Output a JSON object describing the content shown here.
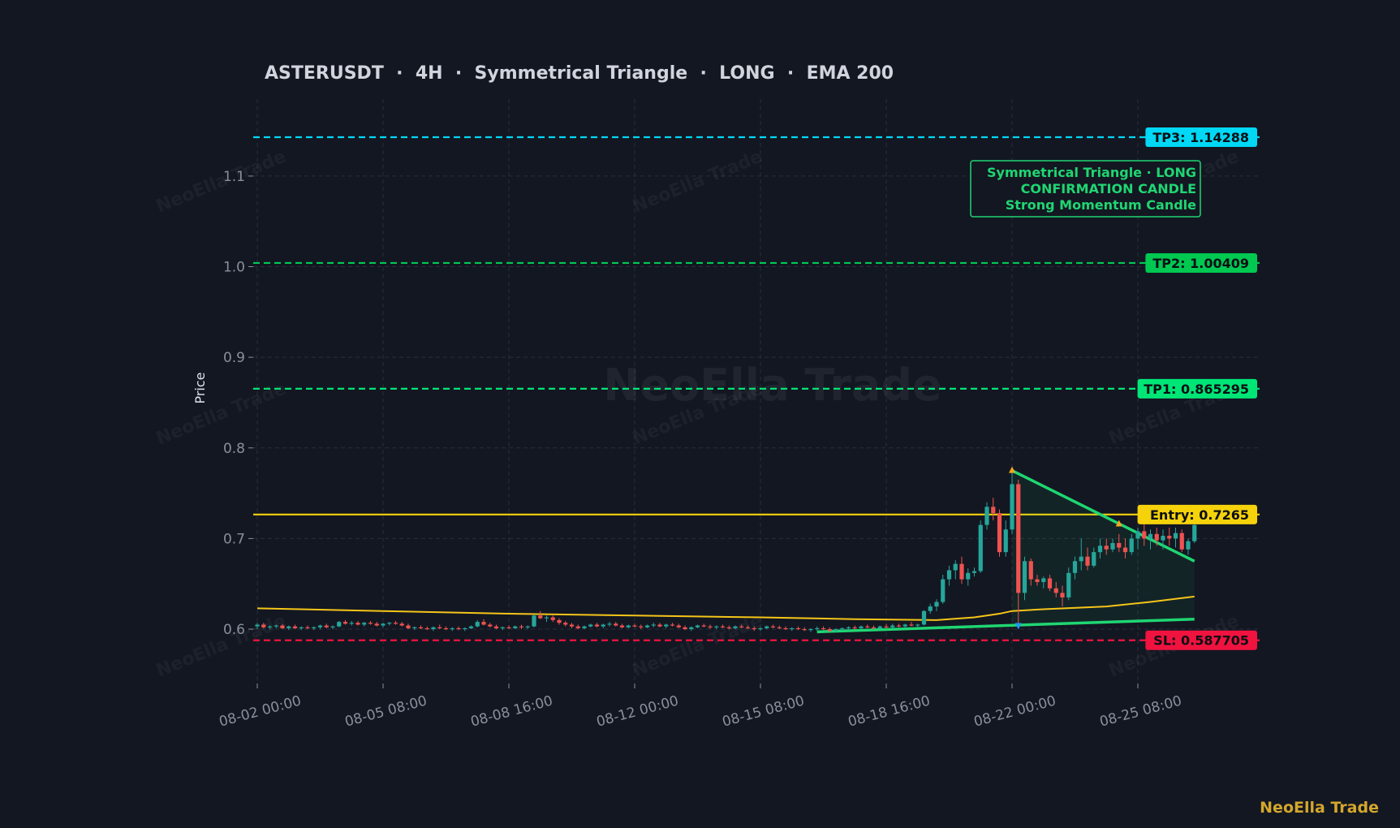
{
  "chart_data": {
    "type": "candlestick",
    "title": "ASTERUSDT  ·  4H  ·  Symmetrical Triangle  ·  LONG  ·  EMA 200",
    "symbol": "ASTERUSDT",
    "timeframe": "4H",
    "ylabel": "Price",
    "xlabel": "",
    "ylim": [
      0.54,
      1.185
    ],
    "y_ticks": [
      0.6,
      0.7,
      0.8,
      0.9,
      1.0,
      1.1
    ],
    "x_ticks": [
      "08-02 00:00",
      "08-05 08:00",
      "08-08 16:00",
      "08-12 00:00",
      "08-15 08:00",
      "08-18 16:00",
      "08-22 00:00",
      "08-25 08:00"
    ],
    "x_tick_bar_index": [
      0,
      20,
      40,
      60,
      80,
      100,
      120,
      140
    ],
    "grid": true,
    "watermark": "NeoElla Trade",
    "levels": [
      {
        "name": "TP3",
        "label": "TP3: 1.14288",
        "value": 1.14288,
        "color": "#00d8f5",
        "style": "dashed"
      },
      {
        "name": "TP2",
        "label": "TP2: 1.00409",
        "value": 1.00409,
        "color": "#00c851",
        "style": "dashed"
      },
      {
        "name": "TP1",
        "label": "TP1: 0.865295",
        "value": 0.865295,
        "color": "#00e676",
        "style": "dashed"
      },
      {
        "name": "Entry",
        "label": "Entry: 0.7265",
        "value": 0.7265,
        "color": "#f5d20a",
        "style": "solid"
      },
      {
        "name": "SL",
        "label": "SL: 0.587705",
        "value": 0.587705,
        "color": "#f0133f",
        "style": "dashed"
      }
    ],
    "annotation": {
      "lines": [
        "Symmetrical Triangle · LONG",
        "CONFIRMATION CANDLE",
        "Strong Momentum Candle"
      ],
      "color": "#1fd672"
    },
    "pattern": {
      "name": "Symmetrical Triangle",
      "upper_line": [
        [
          120,
          0.775
        ],
        [
          149,
          0.675
        ]
      ],
      "lower_line": [
        [
          89,
          0.597
        ],
        [
          149,
          0.611
        ]
      ],
      "peaks": [
        [
          120,
          0.775
        ],
        [
          137,
          0.716
        ]
      ],
      "troughs": [
        [
          121,
          0.604
        ]
      ]
    },
    "ema": {
      "name": "EMA 200",
      "color": "#f5c518",
      "points": [
        [
          0,
          0.623
        ],
        [
          20,
          0.62
        ],
        [
          40,
          0.617
        ],
        [
          60,
          0.615
        ],
        [
          80,
          0.613
        ],
        [
          95,
          0.611
        ],
        [
          108,
          0.61
        ],
        [
          114,
          0.613
        ],
        [
          118,
          0.617
        ],
        [
          120,
          0.62
        ],
        [
          125,
          0.622
        ],
        [
          135,
          0.625
        ],
        [
          142,
          0.63
        ],
        [
          149,
          0.636
        ]
      ]
    },
    "candles": [
      [
        0.603,
        0.607,
        0.6,
        0.605
      ],
      [
        0.605,
        0.607,
        0.601,
        0.602
      ],
      [
        0.602,
        0.604,
        0.6,
        0.603
      ],
      [
        0.603,
        0.605,
        0.601,
        0.604
      ],
      [
        0.604,
        0.606,
        0.6,
        0.601
      ],
      [
        0.601,
        0.604,
        0.599,
        0.603
      ],
      [
        0.603,
        0.605,
        0.6,
        0.601
      ],
      [
        0.601,
        0.603,
        0.599,
        0.602
      ],
      [
        0.602,
        0.604,
        0.6,
        0.601
      ],
      [
        0.601,
        0.603,
        0.599,
        0.602
      ],
      [
        0.602,
        0.605,
        0.6,
        0.604
      ],
      [
        0.604,
        0.606,
        0.601,
        0.602
      ],
      [
        0.602,
        0.604,
        0.6,
        0.603
      ],
      [
        0.603,
        0.609,
        0.602,
        0.608
      ],
      [
        0.608,
        0.61,
        0.605,
        0.606
      ],
      [
        0.606,
        0.609,
        0.604,
        0.607
      ],
      [
        0.607,
        0.609,
        0.604,
        0.605
      ],
      [
        0.605,
        0.608,
        0.603,
        0.607
      ],
      [
        0.607,
        0.609,
        0.605,
        0.606
      ],
      [
        0.606,
        0.608,
        0.603,
        0.604
      ],
      [
        0.604,
        0.607,
        0.602,
        0.606
      ],
      [
        0.606,
        0.608,
        0.604,
        0.607
      ],
      [
        0.607,
        0.609,
        0.605,
        0.606
      ],
      [
        0.606,
        0.608,
        0.603,
        0.604
      ],
      [
        0.604,
        0.606,
        0.6,
        0.601
      ],
      [
        0.601,
        0.603,
        0.599,
        0.602
      ],
      [
        0.602,
        0.604,
        0.6,
        0.601
      ],
      [
        0.601,
        0.603,
        0.599,
        0.6
      ],
      [
        0.6,
        0.603,
        0.598,
        0.602
      ],
      [
        0.602,
        0.605,
        0.6,
        0.601
      ],
      [
        0.601,
        0.603,
        0.599,
        0.6
      ],
      [
        0.6,
        0.602,
        0.598,
        0.601
      ],
      [
        0.601,
        0.603,
        0.599,
        0.6
      ],
      [
        0.6,
        0.602,
        0.598,
        0.601
      ],
      [
        0.601,
        0.604,
        0.6,
        0.603
      ],
      [
        0.603,
        0.61,
        0.602,
        0.608
      ],
      [
        0.608,
        0.611,
        0.604,
        0.605
      ],
      [
        0.605,
        0.607,
        0.602,
        0.603
      ],
      [
        0.603,
        0.605,
        0.6,
        0.601
      ],
      [
        0.601,
        0.603,
        0.599,
        0.602
      ],
      [
        0.602,
        0.604,
        0.6,
        0.601
      ],
      [
        0.601,
        0.604,
        0.6,
        0.603
      ],
      [
        0.603,
        0.605,
        0.6,
        0.602
      ],
      [
        0.602,
        0.604,
        0.6,
        0.603
      ],
      [
        0.603,
        0.616,
        0.602,
        0.615
      ],
      [
        0.615,
        0.62,
        0.611,
        0.612
      ],
      [
        0.612,
        0.615,
        0.608,
        0.613
      ],
      [
        0.613,
        0.615,
        0.608,
        0.61
      ],
      [
        0.61,
        0.612,
        0.605,
        0.607
      ],
      [
        0.607,
        0.609,
        0.603,
        0.605
      ],
      [
        0.605,
        0.607,
        0.601,
        0.603
      ],
      [
        0.603,
        0.605,
        0.6,
        0.601
      ],
      [
        0.601,
        0.604,
        0.6,
        0.603
      ],
      [
        0.603,
        0.606,
        0.602,
        0.605
      ],
      [
        0.605,
        0.607,
        0.602,
        0.603
      ],
      [
        0.603,
        0.606,
        0.601,
        0.605
      ],
      [
        0.605,
        0.608,
        0.603,
        0.606
      ],
      [
        0.606,
        0.608,
        0.603,
        0.604
      ],
      [
        0.604,
        0.606,
        0.601,
        0.602
      ],
      [
        0.602,
        0.605,
        0.601,
        0.604
      ],
      [
        0.604,
        0.606,
        0.602,
        0.603
      ],
      [
        0.603,
        0.605,
        0.6,
        0.602
      ],
      [
        0.602,
        0.605,
        0.601,
        0.604
      ],
      [
        0.604,
        0.607,
        0.602,
        0.605
      ],
      [
        0.605,
        0.607,
        0.602,
        0.603
      ],
      [
        0.603,
        0.606,
        0.601,
        0.605
      ],
      [
        0.605,
        0.607,
        0.603,
        0.604
      ],
      [
        0.604,
        0.606,
        0.601,
        0.602
      ],
      [
        0.602,
        0.604,
        0.599,
        0.6
      ],
      [
        0.6,
        0.603,
        0.598,
        0.602
      ],
      [
        0.602,
        0.605,
        0.601,
        0.604
      ],
      [
        0.604,
        0.606,
        0.602,
        0.603
      ],
      [
        0.603,
        0.605,
        0.6,
        0.602
      ],
      [
        0.602,
        0.604,
        0.6,
        0.603
      ],
      [
        0.603,
        0.605,
        0.601,
        0.602
      ],
      [
        0.602,
        0.604,
        0.6,
        0.601
      ],
      [
        0.601,
        0.604,
        0.6,
        0.603
      ],
      [
        0.603,
        0.605,
        0.601,
        0.602
      ],
      [
        0.602,
        0.604,
        0.6,
        0.601
      ],
      [
        0.601,
        0.603,
        0.598,
        0.6
      ],
      [
        0.6,
        0.602,
        0.598,
        0.601
      ],
      [
        0.601,
        0.604,
        0.6,
        0.603
      ],
      [
        0.603,
        0.605,
        0.601,
        0.602
      ],
      [
        0.602,
        0.604,
        0.6,
        0.601
      ],
      [
        0.601,
        0.603,
        0.599,
        0.6
      ],
      [
        0.6,
        0.602,
        0.598,
        0.601
      ],
      [
        0.601,
        0.603,
        0.599,
        0.6
      ],
      [
        0.6,
        0.602,
        0.598,
        0.599
      ],
      [
        0.599,
        0.601,
        0.597,
        0.6
      ],
      [
        0.6,
        0.603,
        0.598,
        0.601
      ],
      [
        0.601,
        0.603,
        0.599,
        0.6
      ],
      [
        0.6,
        0.602,
        0.597,
        0.598
      ],
      [
        0.598,
        0.601,
        0.597,
        0.6
      ],
      [
        0.6,
        0.602,
        0.598,
        0.601
      ],
      [
        0.601,
        0.603,
        0.599,
        0.602
      ],
      [
        0.602,
        0.604,
        0.6,
        0.601
      ],
      [
        0.601,
        0.604,
        0.6,
        0.603
      ],
      [
        0.603,
        0.605,
        0.601,
        0.602
      ],
      [
        0.602,
        0.604,
        0.6,
        0.601
      ],
      [
        0.601,
        0.604,
        0.6,
        0.603
      ],
      [
        0.603,
        0.606,
        0.601,
        0.602
      ],
      [
        0.602,
        0.606,
        0.601,
        0.604
      ],
      [
        0.604,
        0.606,
        0.602,
        0.603
      ],
      [
        0.603,
        0.606,
        0.601,
        0.605
      ],
      [
        0.605,
        0.608,
        0.603,
        0.604
      ],
      [
        0.604,
        0.606,
        0.602,
        0.605
      ],
      [
        0.605,
        0.621,
        0.604,
        0.62
      ],
      [
        0.62,
        0.628,
        0.617,
        0.625
      ],
      [
        0.625,
        0.633,
        0.62,
        0.63
      ],
      [
        0.63,
        0.66,
        0.628,
        0.655
      ],
      [
        0.655,
        0.67,
        0.648,
        0.665
      ],
      [
        0.665,
        0.676,
        0.655,
        0.672
      ],
      [
        0.672,
        0.68,
        0.65,
        0.655
      ],
      [
        0.655,
        0.667,
        0.648,
        0.662
      ],
      [
        0.662,
        0.668,
        0.658,
        0.664
      ],
      [
        0.664,
        0.72,
        0.662,
        0.715
      ],
      [
        0.715,
        0.74,
        0.71,
        0.735
      ],
      [
        0.735,
        0.745,
        0.72,
        0.728
      ],
      [
        0.728,
        0.732,
        0.68,
        0.685
      ],
      [
        0.685,
        0.72,
        0.68,
        0.71
      ],
      [
        0.71,
        0.775,
        0.705,
        0.76
      ],
      [
        0.76,
        0.765,
        0.604,
        0.64
      ],
      [
        0.64,
        0.68,
        0.632,
        0.675
      ],
      [
        0.675,
        0.678,
        0.648,
        0.655
      ],
      [
        0.655,
        0.66,
        0.648,
        0.652
      ],
      [
        0.652,
        0.658,
        0.645,
        0.656
      ],
      [
        0.656,
        0.66,
        0.642,
        0.645
      ],
      [
        0.645,
        0.652,
        0.635,
        0.64
      ],
      [
        0.64,
        0.648,
        0.625,
        0.635
      ],
      [
        0.635,
        0.668,
        0.632,
        0.662
      ],
      [
        0.662,
        0.68,
        0.655,
        0.675
      ],
      [
        0.675,
        0.7,
        0.665,
        0.68
      ],
      [
        0.68,
        0.69,
        0.665,
        0.67
      ],
      [
        0.67,
        0.69,
        0.668,
        0.685
      ],
      [
        0.685,
        0.7,
        0.678,
        0.692
      ],
      [
        0.692,
        0.7,
        0.682,
        0.688
      ],
      [
        0.688,
        0.7,
        0.685,
        0.695
      ],
      [
        0.695,
        0.705,
        0.685,
        0.69
      ],
      [
        0.69,
        0.7,
        0.678,
        0.685
      ],
      [
        0.685,
        0.705,
        0.682,
        0.7
      ],
      [
        0.7,
        0.712,
        0.688,
        0.708
      ],
      [
        0.708,
        0.716,
        0.692,
        0.7
      ],
      [
        0.7,
        0.71,
        0.688,
        0.705
      ],
      [
        0.705,
        0.712,
        0.692,
        0.698
      ],
      [
        0.698,
        0.71,
        0.688,
        0.703
      ],
      [
        0.703,
        0.712,
        0.692,
        0.7
      ],
      [
        0.7,
        0.712,
        0.69,
        0.706
      ],
      [
        0.706,
        0.71,
        0.685,
        0.688
      ],
      [
        0.688,
        0.7,
        0.682,
        0.697
      ],
      [
        0.697,
        0.718,
        0.695,
        0.715
      ]
    ]
  },
  "branding": {
    "signature": "NeoElla Trade"
  }
}
